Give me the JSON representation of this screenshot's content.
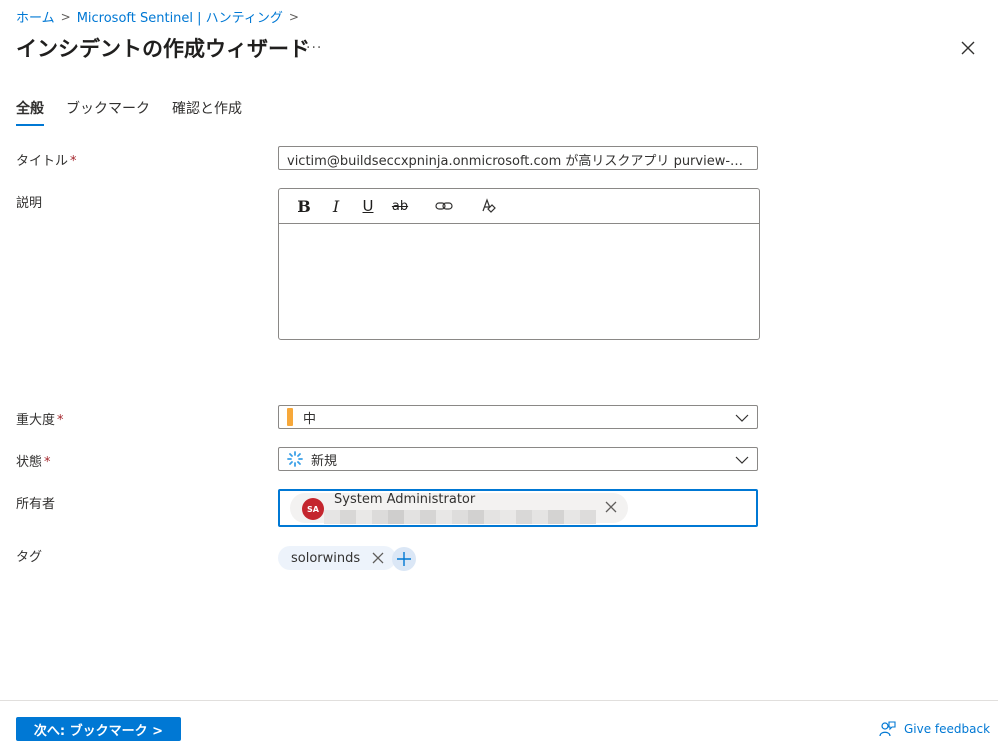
{
  "breadcrumb": {
    "home": "ホーム",
    "hunting": "Microsoft Sentinel | ハンティング",
    "separator": ">"
  },
  "header": {
    "title": "インシデントの作成ウィザード",
    "more": "···"
  },
  "tabs": [
    {
      "label": "全般",
      "active": true
    },
    {
      "label": "ブックマーク",
      "active": false
    },
    {
      "label": "確認と作成",
      "active": false
    }
  ],
  "form": {
    "title_label": "タイトル",
    "title_value": "victim@buildseccxpninja.onmicrosoft.com が高リスクアプリ purview-spn にキ...",
    "description_label": "説明",
    "editor_tools": [
      "bold-icon",
      "italic-icon",
      "underline-icon",
      "strikethrough-icon",
      "link-icon",
      "clear-format-icon"
    ],
    "bold_glyph": "B",
    "italic_glyph": "I",
    "underline_glyph": "U",
    "strike_glyph": "ab",
    "severity_label": "重大度",
    "severity_value": "中",
    "severity_color": "#f7a83a",
    "status_label": "状態",
    "status_value": "新規",
    "owner_label": "所有者",
    "owner_initials": "SA",
    "owner_name": "System Administrator",
    "owner_avatar_color": "#c4262e",
    "tags_label": "タグ",
    "tag_value": "solorwinds",
    "required_mark": "*"
  },
  "footer": {
    "next_button": "次へ: ブックマーク >",
    "feedback": "Give feedback"
  },
  "colors": {
    "accent": "#0078d4",
    "required": "#a4262c"
  }
}
